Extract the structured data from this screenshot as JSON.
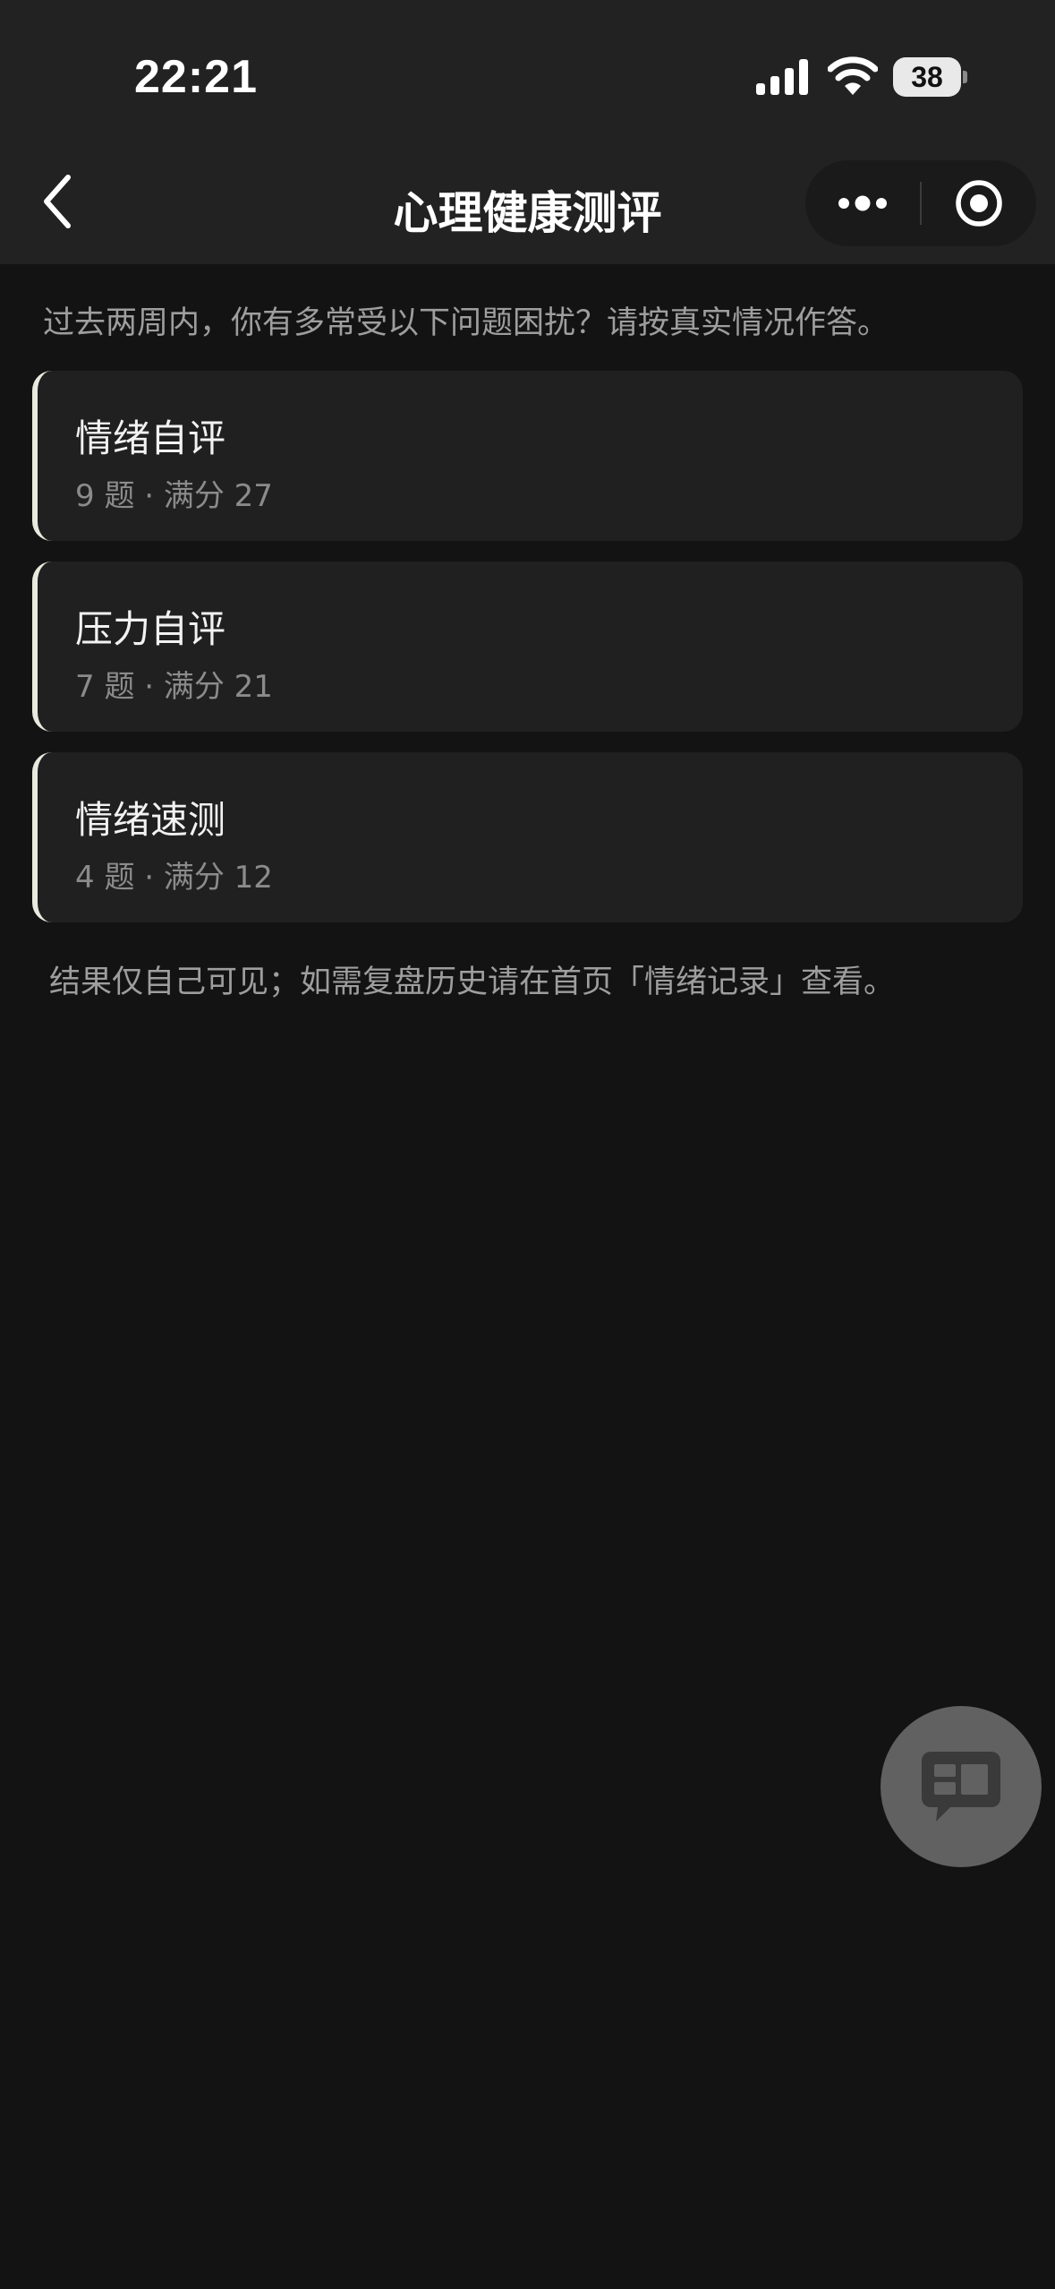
{
  "status_bar": {
    "time": "22:21",
    "battery_level": "38",
    "icons": [
      "signal-icon",
      "wifi-icon",
      "battery-icon"
    ]
  },
  "nav": {
    "title": "心理健康测评",
    "icons": [
      "chevron-left-icon",
      "more-dots-icon",
      "target-circle-icon"
    ]
  },
  "intro": "过去两周内，你有多常受以下问题困扰？请按真实情况作答。",
  "assessments": [
    {
      "title": "情绪自评",
      "meta": "9 题 · 满分 27"
    },
    {
      "title": "压力自评",
      "meta": "7 题 · 满分 21"
    },
    {
      "title": "情绪速测",
      "meta": "4 题 · 满分 12"
    }
  ],
  "footer_note": "结果仅自己可见；如需复盘历史请在首页「情绪记录」查看。",
  "floating_button": {
    "icon": "chat-bubble-icon"
  },
  "colors": {
    "background": "#131313",
    "header_background": "#222222",
    "card_background": "#202020",
    "card_accent": "#e9e9df",
    "muted_text": "#9e9e9e",
    "float_button": "#616161"
  }
}
